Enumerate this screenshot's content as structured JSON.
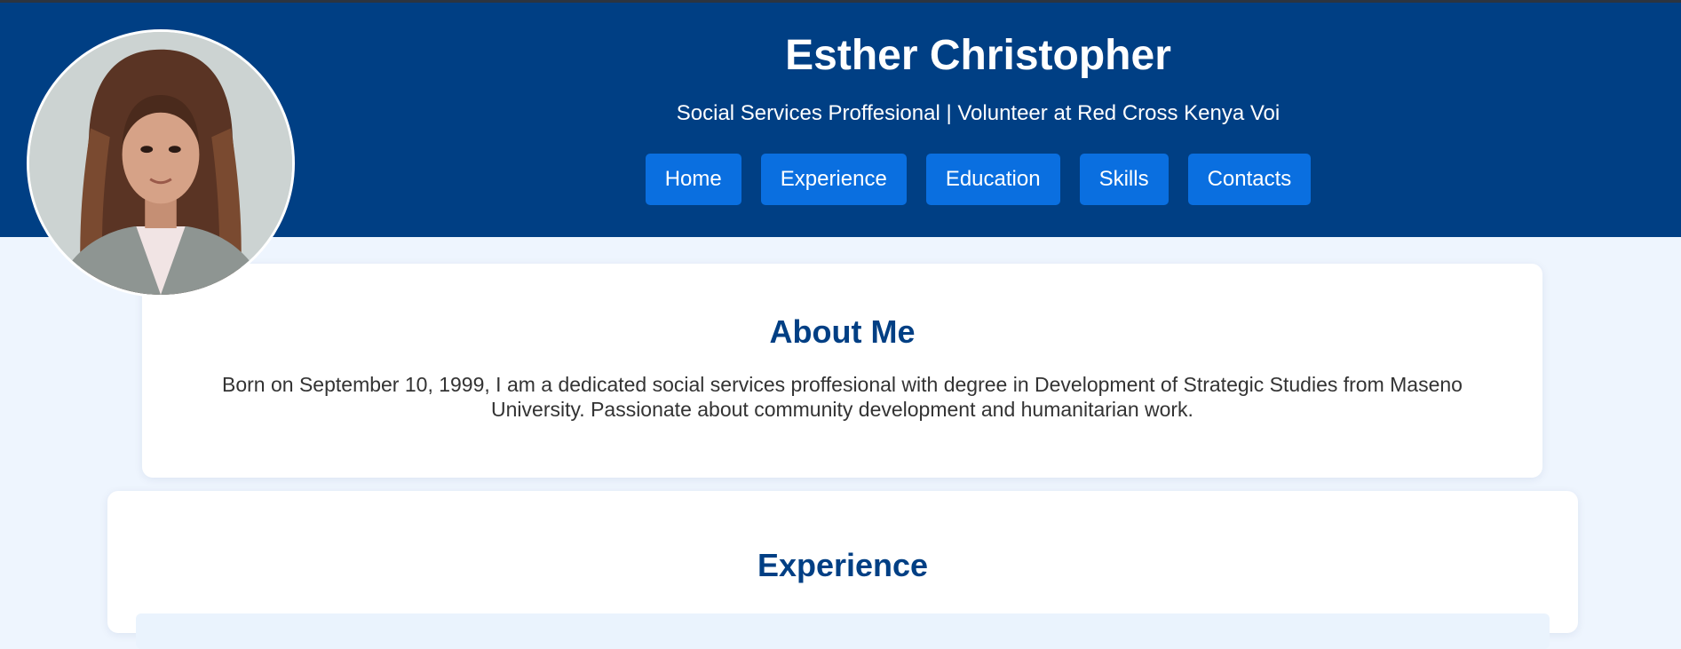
{
  "header": {
    "name": "Esther Christopher",
    "tagline": "Social Services Proffesional | Volunteer at Red Cross Kenya Voi",
    "nav": [
      {
        "label": "Home"
      },
      {
        "label": "Experience"
      },
      {
        "label": "Education"
      },
      {
        "label": "Skills"
      },
      {
        "label": "Contacts"
      }
    ]
  },
  "about": {
    "title": "About Me",
    "text": "Born on September 10, 1999, I am a dedicated social services proffesional with degree in Development of Strategic Studies from Maseno University. Passionate about community development and humanitarian work."
  },
  "experience": {
    "title": "Experience"
  },
  "colors": {
    "header_bg": "#003f84",
    "nav_button": "#0a6fe0",
    "page_bg": "#eef5fe",
    "heading": "#003f84"
  }
}
